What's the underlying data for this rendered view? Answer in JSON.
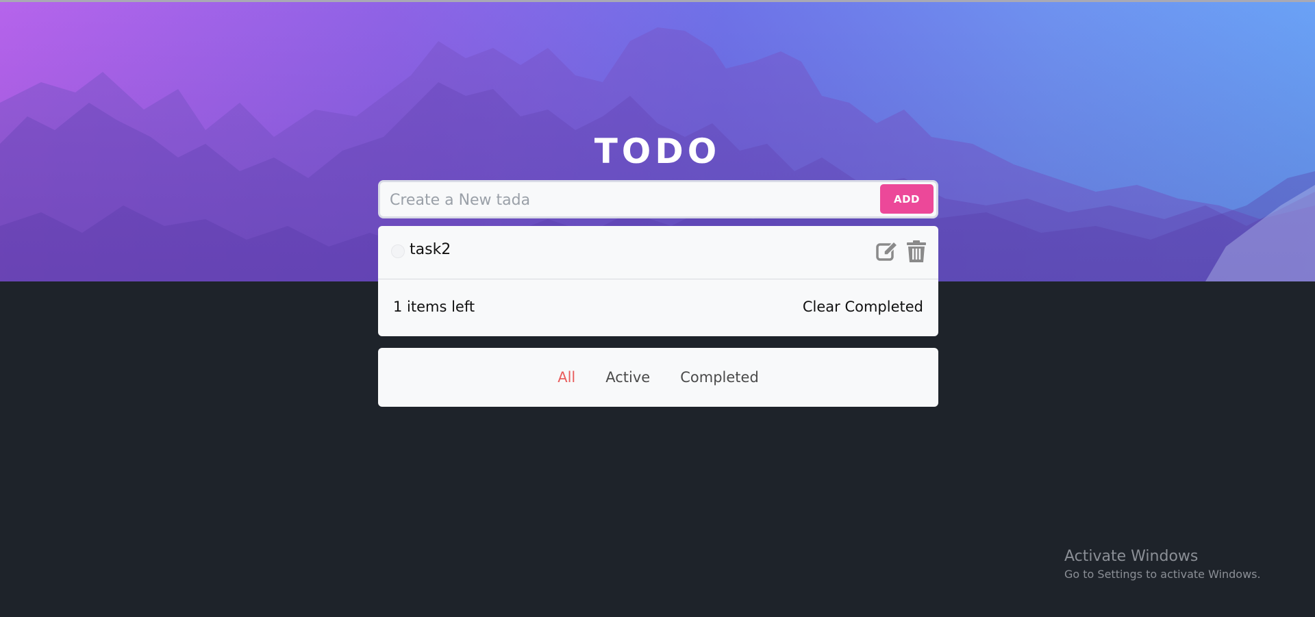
{
  "app": {
    "title": "TODO"
  },
  "new_todo": {
    "placeholder": "Create a New tada",
    "value": "",
    "add_label": "ADD"
  },
  "todos": [
    {
      "text": "task2",
      "completed": false
    }
  ],
  "footer": {
    "items_left": "1 items left",
    "clear_label": "Clear Completed"
  },
  "filters": {
    "all": "All",
    "active": "Active",
    "completed": "Completed",
    "selected": "All"
  },
  "watermark": {
    "title": "Activate Windows",
    "subtitle": "Go to Settings to activate Windows."
  },
  "colors": {
    "accent": "#ec4899",
    "active_filter": "#e95c5c",
    "background": "#1e232a",
    "card": "#f8f9fa"
  },
  "icons": {
    "edit": "edit-icon",
    "delete": "trash-icon"
  }
}
